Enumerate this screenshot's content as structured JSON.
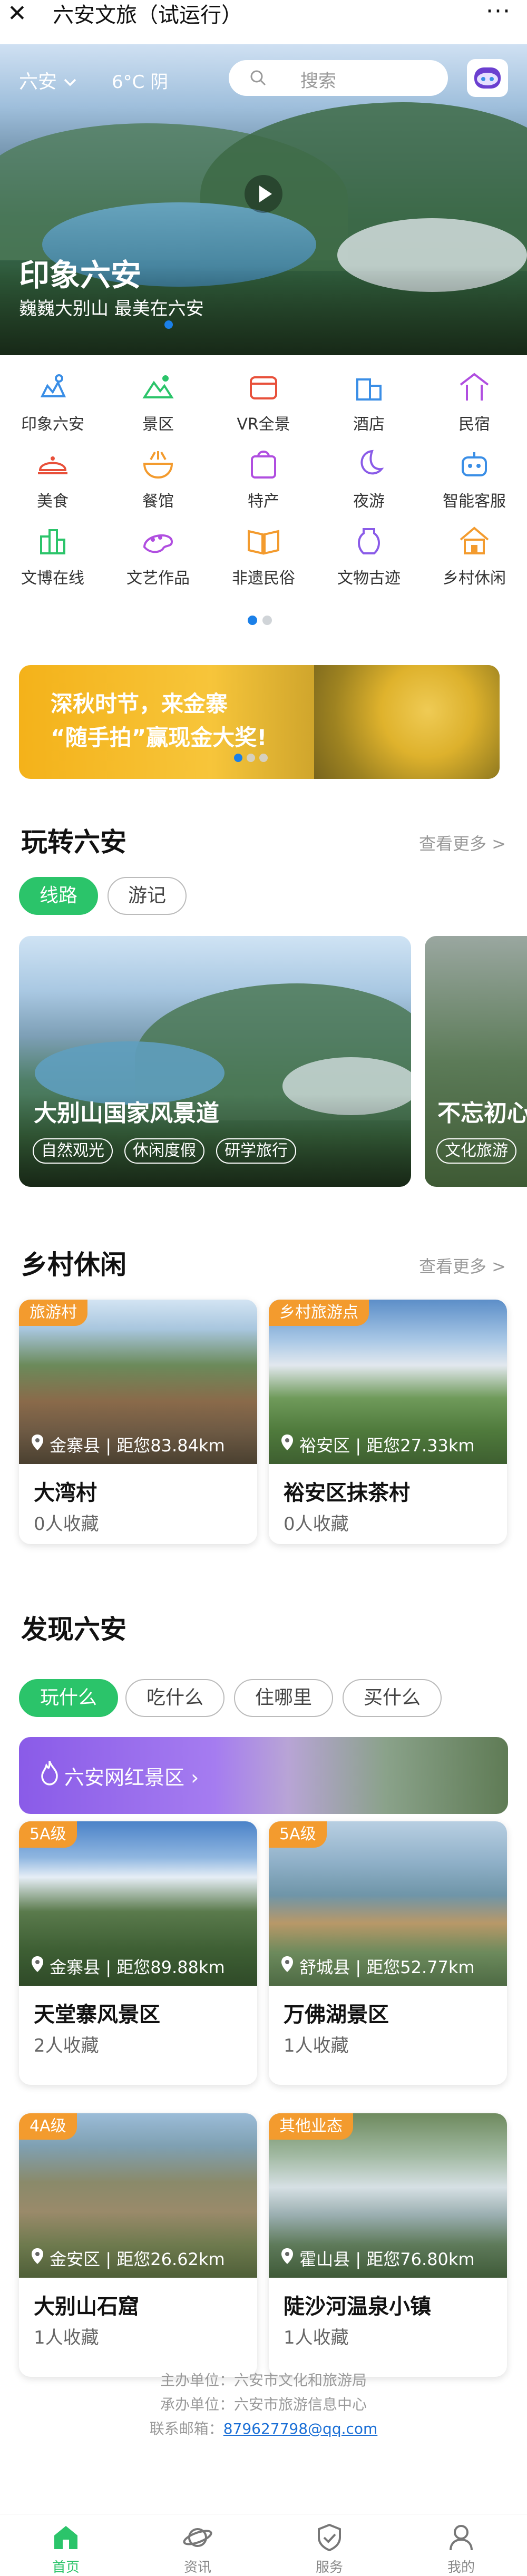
{
  "topbar": {
    "close": "✕",
    "title": "六安文旅（试运行）",
    "more": "···"
  },
  "header": {
    "city": "六安",
    "city_chevron": "chevron-down-icon",
    "weather": "6°C 阴",
    "search_placeholder": "搜索"
  },
  "hero": {
    "title": "印象六安",
    "subtitle": "巍巍大别山 最美在六安",
    "slide_count": 1,
    "active_slide": 0
  },
  "quick_grid": [
    {
      "label": "印象六安",
      "icon": "impression-icon",
      "color": "#3a8ee6"
    },
    {
      "label": "景区",
      "icon": "scenic-icon",
      "color": "#2bc46a"
    },
    {
      "label": "VR全景",
      "icon": "vr-icon",
      "color": "#e8503a"
    },
    {
      "label": "酒店",
      "icon": "hotel-icon",
      "color": "#3a8ee6"
    },
    {
      "label": "民宿",
      "icon": "homestay-icon",
      "color": "#b04ee0"
    },
    {
      "label": "美食",
      "icon": "food-icon",
      "color": "#e8503a"
    },
    {
      "label": "餐馆",
      "icon": "restaurant-icon",
      "color": "#f39b2e"
    },
    {
      "label": "特产",
      "icon": "specialty-icon",
      "color": "#b04ee0"
    },
    {
      "label": "夜游",
      "icon": "night-tour-icon",
      "color": "#8a5be8"
    },
    {
      "label": "智能客服",
      "icon": "robot-icon",
      "color": "#3a8ee6"
    },
    {
      "label": "文博在线",
      "icon": "museum-icon",
      "color": "#2bc46a"
    },
    {
      "label": "文艺作品",
      "icon": "palette-icon",
      "color": "#b04ee0"
    },
    {
      "label": "非遗民俗",
      "icon": "book-icon",
      "color": "#f39b2e"
    },
    {
      "label": "文物古迹",
      "icon": "pottery-icon",
      "color": "#8a5be8"
    },
    {
      "label": "乡村休闲",
      "icon": "village-icon",
      "color": "#f39b2e"
    }
  ],
  "banner": {
    "line1": "深秋时节，来金寨",
    "line2": "“随手拍”赢现金大奖!"
  },
  "play": {
    "title": "玩转六安",
    "more": "查看更多 >",
    "tabs": [
      "线路",
      "游记"
    ],
    "active_tab": 0,
    "cards": [
      {
        "name": "大别山国家风景道",
        "tags": [
          "自然观光",
          "休闲度假",
          "研学旅行"
        ]
      },
      {
        "name": "不忘初心",
        "tags": [
          "文化旅游"
        ]
      }
    ]
  },
  "rural": {
    "title": "乡村休闲",
    "more": "查看更多 >",
    "cards": [
      {
        "badge": "旅游村",
        "location": "金寨县 | 距您83.84km",
        "name": "大湾村",
        "favorites": "0人收藏"
      },
      {
        "badge": "乡村旅游点",
        "location": "裕安区 | 距您27.33km",
        "name": "裕安区抹茶村",
        "favorites": "0人收藏"
      }
    ]
  },
  "discover": {
    "title": "发现六安",
    "tabs": [
      "玩什么",
      "吃什么",
      "住哪里",
      "买什么"
    ],
    "active_tab": 0,
    "netred_label": "六安网红景区 ›",
    "cards": [
      {
        "badge": "5A级",
        "location": "金寨县 | 距您89.88km",
        "name": "天堂寨风景区",
        "favorites": "2人收藏"
      },
      {
        "badge": "5A级",
        "location": "舒城县 | 距您52.77km",
        "name": "万佛湖景区",
        "favorites": "1人收藏"
      },
      {
        "badge": "4A级",
        "location": "金安区 | 距您26.62km",
        "name": "大别山石窟",
        "favorites": "1人收藏"
      },
      {
        "badge": "其他业态",
        "location": "霍山县 | 距您76.80km",
        "name": "陡沙河温泉小镇",
        "favorites": "1人收藏"
      }
    ]
  },
  "footer": {
    "sponsor": "主办单位：六安市文化和旅游局",
    "organizer": "承办单位：六安市旅游信息中心",
    "email_label": "联系邮箱：",
    "email": "879627798@qq.com"
  },
  "tabbar": [
    {
      "label": "首页",
      "icon": "home-icon"
    },
    {
      "label": "资讯",
      "icon": "planet-icon"
    },
    {
      "label": "服务",
      "icon": "shield-check-icon"
    },
    {
      "label": "我的",
      "icon": "user-icon"
    }
  ],
  "colors": {
    "accent_green": "#2bc46a",
    "badge_orange": "#f39b2e",
    "link_blue": "#1b6fd6"
  }
}
